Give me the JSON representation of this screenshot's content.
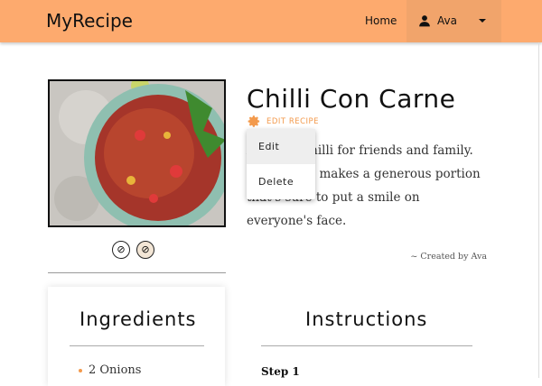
{
  "header": {
    "brand": "MyRecipe",
    "home": "Home",
    "user": "Ava",
    "accent": "#fdaa6e"
  },
  "recipe": {
    "title": "Chilli Con Carne",
    "edit_label": "EDIT RECIPE",
    "description": "A hearty chilli for friends and family. This recipe makes a generous portion that's sure to put a smile on everyone's face.",
    "created_by": "~ Created by Ava",
    "diet_icons": [
      "no-nuts-icon",
      "no-gluten-icon"
    ]
  },
  "menu": {
    "items": [
      {
        "label": "Edit"
      },
      {
        "label": "Delete"
      }
    ]
  },
  "ingredients": {
    "title": "Ingredients",
    "items": [
      "2 Onions"
    ]
  },
  "instructions": {
    "title": "Instructions",
    "steps": [
      "Step 1"
    ]
  }
}
